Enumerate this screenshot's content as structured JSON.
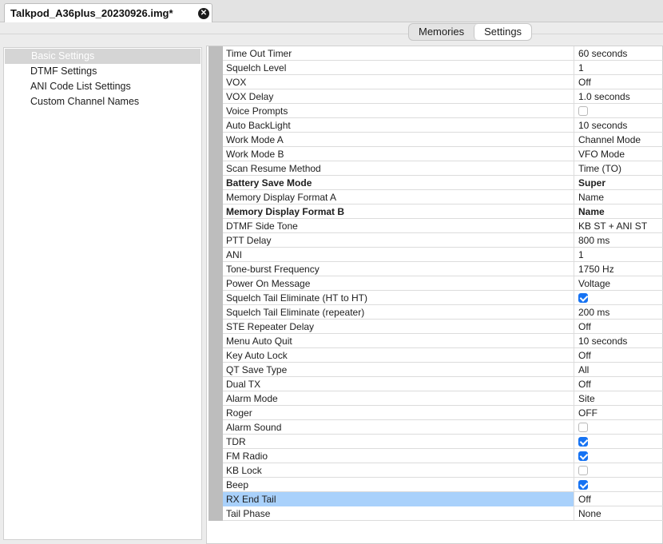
{
  "file_tab": {
    "title": "Talkpod_A36plus_20230926.img*"
  },
  "view_tabs": [
    {
      "label": "Memories",
      "active": false
    },
    {
      "label": "Settings",
      "active": true
    }
  ],
  "sidebar": {
    "items": [
      {
        "label": "Basic Settings",
        "selected": true
      },
      {
        "label": "DTMF Settings",
        "selected": false
      },
      {
        "label": "ANI Code List Settings",
        "selected": false
      },
      {
        "label": "Custom Channel Names",
        "selected": false
      }
    ]
  },
  "settings": [
    {
      "name": "Time Out Timer",
      "value": "60 seconds"
    },
    {
      "name": "Squelch Level",
      "value": "1"
    },
    {
      "name": "VOX",
      "value": "Off"
    },
    {
      "name": "VOX Delay",
      "value": "1.0 seconds"
    },
    {
      "name": "Voice Prompts",
      "checkbox": false
    },
    {
      "name": "Auto BackLight",
      "value": "10 seconds"
    },
    {
      "name": "Work Mode A",
      "value": "Channel Mode"
    },
    {
      "name": "Work Mode B",
      "value": "VFO Mode"
    },
    {
      "name": "Scan Resume Method",
      "value": "Time (TO)"
    },
    {
      "name": "Battery Save Mode",
      "value": "Super",
      "bold": true
    },
    {
      "name": "Memory Display Format A",
      "value": "Name"
    },
    {
      "name": "Memory Display Format B",
      "value": "Name",
      "bold": true
    },
    {
      "name": "DTMF Side Tone",
      "value": "KB ST + ANI ST"
    },
    {
      "name": "PTT Delay",
      "value": "800 ms"
    },
    {
      "name": "ANI",
      "value": "1"
    },
    {
      "name": "Tone-burst Frequency",
      "value": "1750 Hz"
    },
    {
      "name": "Power On Message",
      "value": "Voltage"
    },
    {
      "name": "Squelch Tail Eliminate (HT to HT)",
      "checkbox": true
    },
    {
      "name": "Squelch Tail Eliminate (repeater)",
      "value": "200 ms"
    },
    {
      "name": "STE Repeater Delay",
      "value": "Off"
    },
    {
      "name": "Menu Auto Quit",
      "value": "10 seconds"
    },
    {
      "name": "Key Auto Lock",
      "value": "Off"
    },
    {
      "name": "QT Save Type",
      "value": "All"
    },
    {
      "name": "Dual TX",
      "value": "Off"
    },
    {
      "name": "Alarm Mode",
      "value": "Site"
    },
    {
      "name": "Roger",
      "value": "OFF"
    },
    {
      "name": "Alarm Sound",
      "checkbox": false
    },
    {
      "name": "TDR",
      "checkbox": true
    },
    {
      "name": "FM Radio",
      "checkbox": true
    },
    {
      "name": "KB Lock",
      "checkbox": false
    },
    {
      "name": "Beep",
      "checkbox": true
    },
    {
      "name": "RX End Tail",
      "value": "Off",
      "highlight": true
    },
    {
      "name": "Tail Phase",
      "value": "None"
    }
  ],
  "colors": {
    "highlight": "#a9d1fb",
    "checkbox_on": "#1673f3"
  }
}
